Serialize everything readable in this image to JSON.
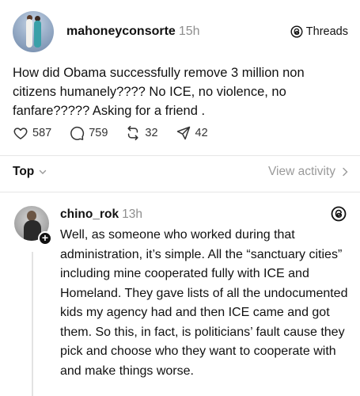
{
  "post": {
    "username": "mahoneyconsorte",
    "time": "15h",
    "badge": "Threads",
    "text": "How did Obama successfully remove 3 million non citizens humanely???? No ICE, no violence, no fanfare????? Asking for a friend .",
    "likes": "587",
    "replies": "759",
    "reposts": "32",
    "shares": "42"
  },
  "sort": {
    "label": "Top",
    "view_activity": "View activity"
  },
  "reply": {
    "username": "chino_rok",
    "time": "13h",
    "text": "Well, as someone who worked during that administration, it’s simple. All the “sanctuary cities” including mine cooperated fully with ICE and Homeland. They gave lists of all the undocumented kids my agency had and then ICE came and got them. So this, in fact, is politicians’ fault cause they pick and choose who they want to cooperate with and make things worse."
  },
  "icons": {
    "like": "heart-icon",
    "reply": "comment-icon",
    "repost": "repost-icon",
    "share": "share-icon",
    "threads": "threads-logo-icon"
  }
}
